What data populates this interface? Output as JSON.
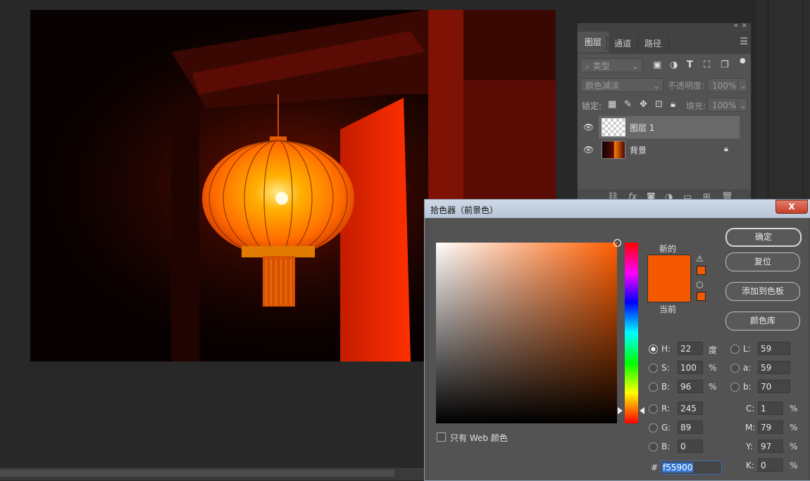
{
  "layers_panel": {
    "collapse_icon": "double-chevron-left-icon",
    "close_icon": "close-icon",
    "tabs": [
      "图层",
      "通道",
      "路径"
    ],
    "active_tab": "图层",
    "filter_kind": "类型",
    "blend_mode": "颜色减淡",
    "opacity_label": "不透明度:",
    "opacity_value": "100%",
    "lock_label": "锁定:",
    "fill_label": "填充:",
    "fill_value": "100%",
    "layers": [
      {
        "name": "图层 1",
        "selected": true,
        "visible": true
      },
      {
        "name": "背景",
        "selected": false,
        "visible": true,
        "locked": true
      }
    ]
  },
  "color_picker": {
    "title": "拾色器（前景色）",
    "close_label": "X",
    "new_label": "新的",
    "current_label": "当前",
    "new_color": "#f55900",
    "current_color": "#f55900",
    "buttons": {
      "ok": "确定",
      "reset": "复位",
      "add_to_swatches": "添加到色板",
      "color_libraries": "颜色库"
    },
    "only_web_label": "只有 Web 颜色",
    "hsb": {
      "h_label": "H:",
      "h": "22",
      "h_unit": "度",
      "s_label": "S:",
      "s": "100",
      "s_unit": "%",
      "b_label": "B:",
      "b": "96",
      "b_unit": "%"
    },
    "rgb": {
      "r_label": "R:",
      "r": "245",
      "g_label": "G:",
      "g": "89",
      "b_label": "B:",
      "b": "0"
    },
    "lab": {
      "l_label": "L:",
      "l": "59",
      "a_label": "a:",
      "a": "59",
      "b_label": "b:",
      "b": "70"
    },
    "cmyk": {
      "c_label": "C:",
      "c": "1",
      "m_label": "M:",
      "m": "79",
      "y_label": "Y:",
      "y": "97",
      "k_label": "K:",
      "k": "0",
      "unit": "%"
    },
    "hex_label": "#",
    "hex": "f55900"
  }
}
